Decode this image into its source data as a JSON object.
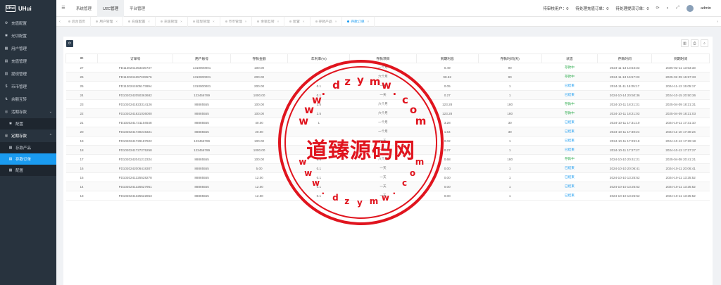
{
  "brand": {
    "logo_box": "UHui",
    "name": "UHui"
  },
  "sidebar": {
    "items": [
      {
        "label": "充值配置",
        "icon": "gear-icon",
        "glyph": "⚙"
      },
      {
        "label": "光切配置",
        "icon": "gear-icon",
        "glyph": "✱"
      },
      {
        "label": "用户管理",
        "icon": "users-icon",
        "glyph": "▦"
      },
      {
        "label": "充值管理",
        "icon": "wallet-icon",
        "glyph": "▤"
      },
      {
        "label": "提现管理",
        "icon": "withdraw-icon",
        "glyph": "▥"
      },
      {
        "label": "币币管理",
        "icon": "coin-icon",
        "glyph": "$"
      },
      {
        "label": "余额互转",
        "icon": "transfer-icon",
        "glyph": "⇅"
      }
    ],
    "group1": {
      "label": "活期存款",
      "icon": "piggy-icon",
      "glyph": "◎",
      "sub": [
        {
          "label": "配置",
          "glyph": "✱"
        }
      ]
    },
    "group2": {
      "label": "定期存款",
      "icon": "piggy-icon",
      "glyph": "◎",
      "sub": [
        {
          "label": "存款产品",
          "glyph": "▦"
        },
        {
          "label": "存款订单",
          "glyph": "▤"
        },
        {
          "label": "配置",
          "glyph": "▦"
        }
      ]
    }
  },
  "topbar": {
    "nav": [
      "系统管理",
      "U2C管理",
      "平台管理"
    ],
    "active_nav": 1,
    "status": {
      "pending_users": "待审核用户：0",
      "pending_recharge": "待处理充值订单：0",
      "pending_withdraw": "待处理提现订单：0"
    },
    "user": "admin"
  },
  "tabs": [
    "后台首页",
    "用户管理",
    "充值配置",
    "充值管理",
    "提现管理",
    "币币管理",
    "余额互转",
    "配置",
    "存款产品",
    "存款订单"
  ],
  "active_tab": 9,
  "table": {
    "headers": [
      "ID",
      "订单号",
      "用户账号",
      "存款金额",
      "年利率(%)",
      "存款项目",
      "到期利息",
      "存款时间(天)",
      "状态",
      "存款时间",
      "到期时间"
    ],
    "rows": [
      [
        "27",
        "FD1120241353335737",
        "1310000001",
        "100.00",
        "",
        "一个月",
        "0.49",
        "90",
        "存款中",
        "2024-11-13 13:53:33",
        "2025-02-11 13:53:33"
      ],
      [
        "26",
        "FD1120241657339576",
        "1310000001",
        "200.00",
        "",
        "六个月",
        "98.62",
        "90",
        "存款中",
        "2024-11-13 16:57:33",
        "2025-02-09 16:57:33"
      ],
      [
        "25",
        "FD1120241505173894",
        "1310000001",
        "200.00",
        "0.1",
        "一天",
        "0.05",
        "1",
        "已结束",
        "2024-11-11 15:05:17",
        "2024-11-12 15:05:17"
      ],
      [
        "24",
        "FD1020242050363682",
        "123456789",
        "1000.00",
        "0.1",
        "一天",
        "0.27",
        "1",
        "已结束",
        "2024-10-14 20:50:36",
        "2024-10-15 20:50:36"
      ],
      [
        "23",
        "FD1020241823314126",
        "88885555",
        "100.00",
        "2.5",
        "六个月",
        "123.28",
        "180",
        "存款中",
        "2024-10-11 18:21:31",
        "2025-04-09 18:21:31"
      ],
      [
        "22",
        "FD1020241821036000",
        "88885555",
        "100.00",
        "2.5",
        "六个月",
        "123.28",
        "180",
        "存款中",
        "2024-10-11 18:21:03",
        "2025-04-09 18:21:03"
      ],
      [
        "21",
        "FD1020241731104548",
        "88885555",
        "40.00",
        "1",
        "一个月",
        "3.28",
        "30",
        "已结束",
        "2024-10-11 17:31:10",
        "2024-10-11 17:31:10"
      ],
      [
        "20",
        "FD1020241730246321",
        "88885555",
        "20.00",
        "",
        "一个月",
        "1.64",
        "30",
        "已结束",
        "2024-10-11 17:30:24",
        "2024-11-10 17:30:24"
      ],
      [
        "19",
        "FD1020241729187922",
        "123456789",
        "100.00",
        "",
        "一天",
        "0.02",
        "1",
        "已结束",
        "2024-10-11 17:29:18",
        "2024-10-12 17:29:18"
      ],
      [
        "18",
        "FD1020241727275258",
        "123456789",
        "1000.00",
        "0.1",
        "一天",
        "0.27",
        "1",
        "已结束",
        "2024-10-11 17:27:27",
        "2024-10-12 17:27:27"
      ],
      [
        "17",
        "FD1020242041212324",
        "88885555",
        "100.00",
        "2.5",
        "六个月",
        "0.68",
        "180",
        "存款中",
        "2024-10-10 20:41:21",
        "2025-04-08 20:41:21"
      ],
      [
        "16",
        "FD1020242006418307",
        "88885555",
        "5.00",
        "0.1",
        "一天",
        "0.00",
        "1",
        "已结束",
        "2024-10-10 20:06:41",
        "2024-10-11 20:06:41"
      ],
      [
        "15",
        "FD1020241325528278",
        "88885555",
        "12.00",
        "0.1",
        "一天",
        "0.00",
        "1",
        "已结束",
        "2024-10-10 13:25:52",
        "2024-10-11 13:25:52"
      ],
      [
        "14",
        "FD1020241325527951",
        "88885555",
        "12.00",
        "0.1",
        "一天",
        "0.00",
        "1",
        "已结束",
        "2024-10-10 13:25:52",
        "2024-10-11 13:25:52"
      ],
      [
        "13",
        "FD1020241325522853",
        "88885555",
        "12.00",
        "0.1",
        "一天",
        "0.00",
        "1",
        "已结束",
        "2024-10-10 13:25:52",
        "2024-10-11 13:25:52"
      ]
    ]
  },
  "watermark": {
    "center": "道臻源码网",
    "top_letters": [
      "w",
      "w",
      "w",
      ".",
      "d",
      "z",
      "y",
      "m",
      "w",
      ".",
      "c",
      "o",
      "m"
    ],
    "bottom_letters": [
      "w",
      "w",
      "w",
      ".",
      "d",
      "z",
      "y",
      "m",
      "w",
      ".",
      "c",
      "o",
      "m"
    ]
  },
  "colors": {
    "accent": "#1a9bf0",
    "sidebar": "#28333e",
    "stamp": "#e0141e",
    "status_on": "#2aaa4a"
  }
}
